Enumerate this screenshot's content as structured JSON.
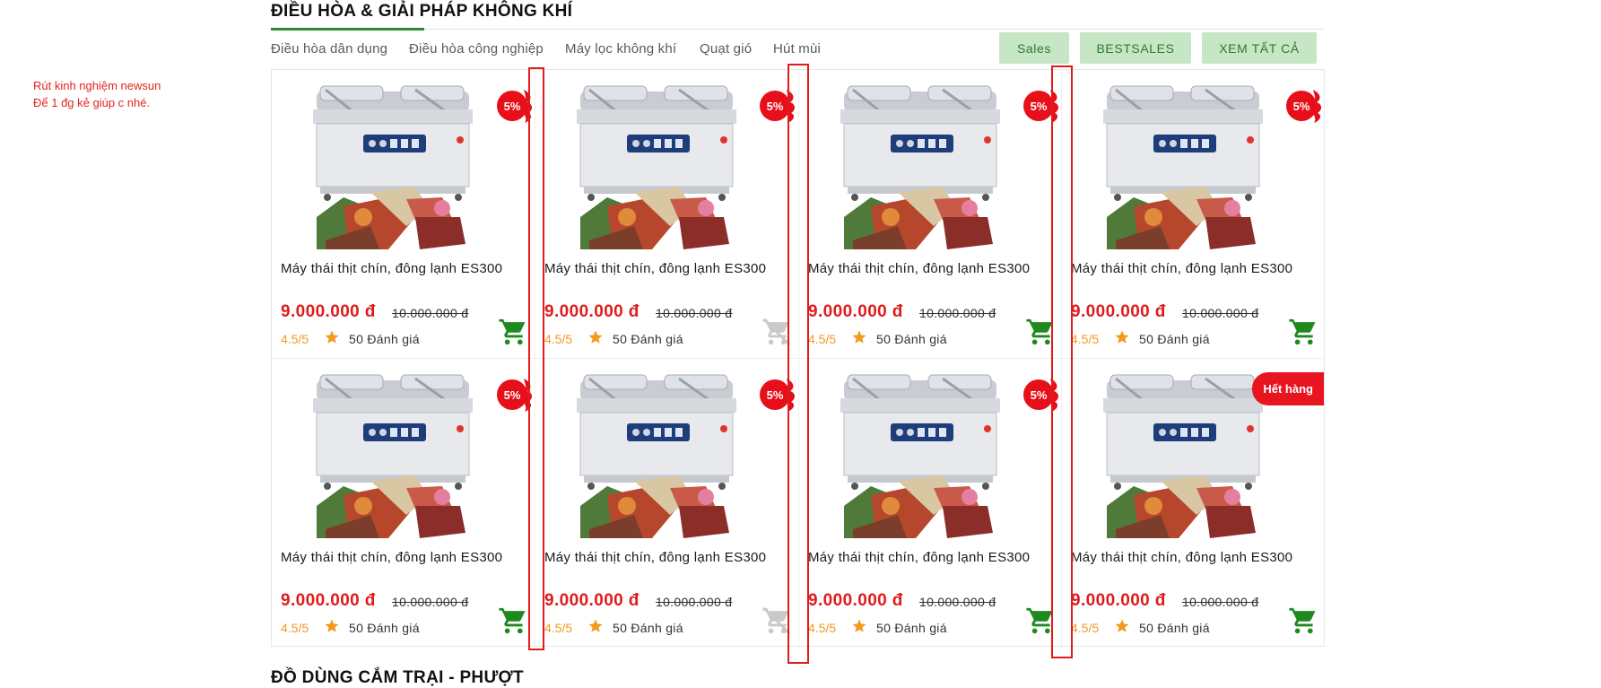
{
  "note": {
    "line1": "Rút kinh nghiệm newsun",
    "line2": "Để 1 đg kẻ giúp c nhé."
  },
  "section": {
    "title": "ĐIỀU HÒA & GIẢI PHÁP KHÔNG KHÍ",
    "tabs": [
      "Điều hòa dân dụng",
      "Điều hòa công nghiệp",
      "Máy lọc không khí",
      "Quạt gió",
      "Hút mùi"
    ],
    "buttons": [
      "Sales",
      "BESTSALES",
      "XEM TẤT CẢ"
    ]
  },
  "products": [
    {
      "name": "Máy thái thịt chín, đông lạnh ES300",
      "price": "9.000.000 đ",
      "old_price": "10.000.000 đ",
      "badge": "5%",
      "rating": "4.5/5",
      "reviews": "50 Đánh giá",
      "cart_icon": "cart-icon",
      "in_stock": true
    },
    {
      "name": "Máy thái thịt chín, đông lạnh ES300",
      "price": "9.000.000 đ",
      "old_price": "10.000.000 đ",
      "badge": "5%",
      "rating": "4.5/5",
      "reviews": "50 Đánh giá",
      "cart_icon": "cart-disabled-icon",
      "in_stock": false
    },
    {
      "name": "Máy thái thịt chín, đông lạnh ES300",
      "price": "9.000.000 đ",
      "old_price": "10.000.000 đ",
      "badge": "5%",
      "rating": "4.5/5",
      "reviews": "50 Đánh giá",
      "cart_icon": "cart-icon",
      "in_stock": true
    },
    {
      "name": "Máy thái thịt chín, đông lạnh ES300",
      "price": "9.000.000 đ",
      "old_price": "10.000.000 đ",
      "badge": "5%",
      "rating": "4.5/5",
      "reviews": "50 Đánh giá",
      "cart_icon": "cart-icon",
      "in_stock": true
    },
    {
      "name": "Máy thái thịt chín, đông lạnh ES300",
      "price": "9.000.000 đ",
      "old_price": "10.000.000 đ",
      "badge": "5%",
      "rating": "4.5/5",
      "reviews": "50 Đánh giá",
      "cart_icon": "cart-icon",
      "in_stock": true
    },
    {
      "name": "Máy thái thịt chín, đông lạnh ES300",
      "price": "9.000.000 đ",
      "old_price": "10.000.000 đ",
      "badge": "5%",
      "rating": "4.5/5",
      "reviews": "50 Đánh giá",
      "cart_icon": "cart-disabled-icon",
      "in_stock": false
    },
    {
      "name": "Máy thái thịt chín, đông lạnh ES300",
      "price": "9.000.000 đ",
      "old_price": "10.000.000 đ",
      "badge": "5%",
      "rating": "4.5/5",
      "reviews": "50 Đánh giá",
      "cart_icon": "cart-icon",
      "in_stock": true
    },
    {
      "name": "Máy thái thịt chín, đông lạnh ES300",
      "price": "9.000.000 đ",
      "old_price": "10.000.000 đ",
      "badge": "Hết hàng",
      "rating": "4.5/5",
      "reviews": "50 Đánh giá",
      "cart_icon": "cart-icon",
      "in_stock": true
    }
  ],
  "next_section": {
    "title": "ĐỒ DÙNG CẮM TRẠI - PHƯỢT"
  },
  "colors": {
    "accent_green": "#2e8b34",
    "pill_bg": "#c7e6c6",
    "price_red": "#e01b1b",
    "badge_red": "#e60f1a",
    "star_orange": "#f39a1e",
    "annotation_red": "#e01b1b"
  }
}
